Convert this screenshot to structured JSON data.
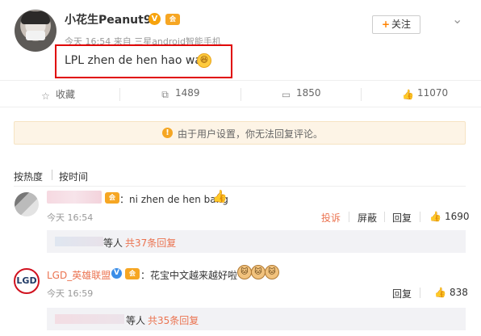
{
  "post": {
    "username": "小花生Peanut98",
    "v_badge": "V",
    "vip_badge": "会",
    "meta": "今天 16:54 来自 三星android智能手机",
    "text": "LPL zhen de hen hao wan",
    "emoji_icon": "laughing-emoji",
    "follow_label": "关注",
    "follow_plus": "+",
    "more_icon": "chevron-down"
  },
  "actions": {
    "favorite": "收藏",
    "repost": "1489",
    "comment": "1850",
    "like": "11070"
  },
  "notice": {
    "icon": "!",
    "text": "由于用户设置，你无法回复评论。",
    "colors": {
      "background": "#fdf4e6",
      "icon": "#f5a623"
    }
  },
  "sort": {
    "hot": "按热度",
    "time": "按时间"
  },
  "comments": [
    {
      "text": "：ni zhen de hen bang",
      "time": "今天 16:54",
      "report": "投诉",
      "block": "屏蔽",
      "reply": "回复",
      "likes": "1690",
      "sub": {
        "text": "等人",
        "link": "共37条回复"
      }
    },
    {
      "name": "LGD_英雄联盟",
      "avatar_text": "LGD",
      "text": "：花宝中文越来越好啦",
      "time": "今天 16:59",
      "reply": "回复",
      "likes": "838",
      "sub": {
        "text": "等人",
        "link": "共35条回复"
      }
    }
  ],
  "colors": {
    "accent": "#eb7350",
    "highlight_box": "#e00000",
    "follow_plus": "#ff8200"
  }
}
